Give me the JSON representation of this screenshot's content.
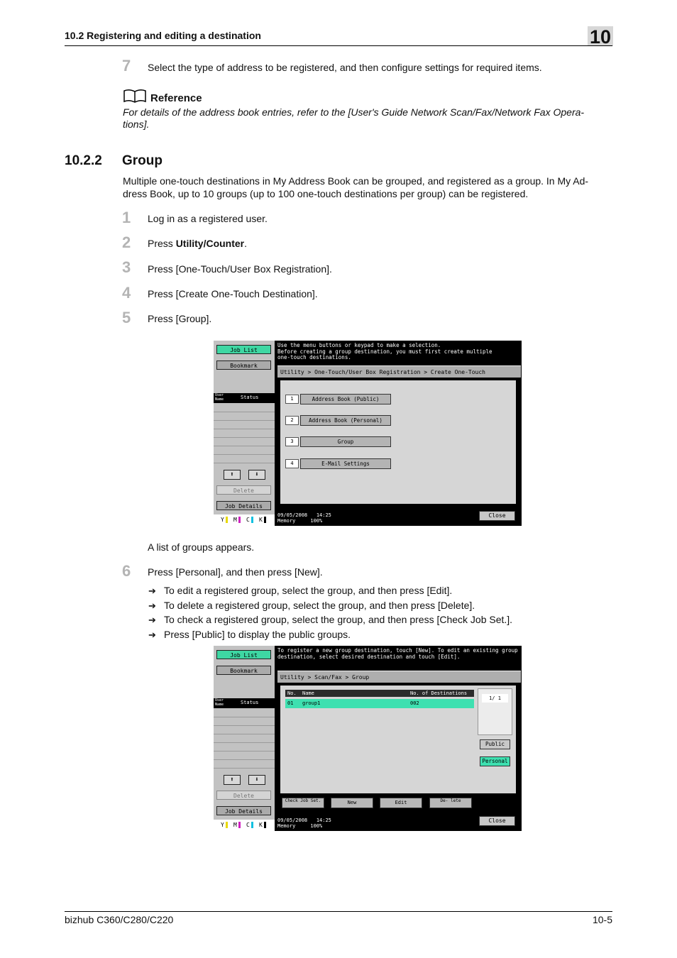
{
  "header": {
    "section": "10.2    Registering and editing a destination",
    "chapter": "10"
  },
  "footer": {
    "product": "bizhub C360/C280/C220",
    "page": "10-5"
  },
  "step7": {
    "num": "7",
    "text": "Select the type of address to be registered, and then configure settings for required items."
  },
  "reference": {
    "title": "Reference",
    "line1": "For details of the address book entries, refer to the [User's Guide Network Scan/Fax/Network Fax Opera-",
    "line2": "tions]."
  },
  "section": {
    "number": "10.2.2",
    "title": "Group",
    "intro1": "Multiple one-touch destinations in My Address Book can be grouped, and registered as a group. In My Ad-",
    "intro2": "dress Book, up to 10 groups (up to 100 one-touch destinations per group) can be registered."
  },
  "steps": [
    {
      "num": "1",
      "text": "Log in as a registered user."
    },
    {
      "num": "2",
      "text_pre": "Press ",
      "text_bold": "Utility/Counter",
      "text_post": "."
    },
    {
      "num": "3",
      "text": "Press [One-Touch/User Box Registration]."
    },
    {
      "num": "4",
      "text": "Press [Create One-Touch Destination]."
    },
    {
      "num": "5",
      "text": "Press [Group]."
    }
  ],
  "after5": "A list of groups appears.",
  "step6": {
    "num": "6",
    "text": "Press [Personal], and then press [New].",
    "bullets": [
      "To edit a registered group, select the group, and then press [Edit].",
      "To delete a registered group, select the group, and then press [Delete].",
      "To check a registered group, select the group, and then press [Check Job Set.].",
      "Press [Public] to display the public groups."
    ],
    "arrow_glyph": "➔"
  },
  "screen_common": {
    "job_list": "Job List",
    "bookmark": "Bookmark",
    "user_name": "User Name",
    "status": "Status",
    "up": "⬆",
    "down": "⬇",
    "delete": "Delete",
    "job_details": "Job Details",
    "toner": [
      "Y",
      "M",
      "C",
      "K"
    ],
    "date": "09/05/2008",
    "time": "14:25",
    "memory_label": "Memory",
    "memory_value": "100%",
    "close": "Close"
  },
  "screen1": {
    "message": [
      "Use the menu buttons or keypad to make a selection.",
      "Before creating a group destination, you must first create multiple",
      "one-touch destinations."
    ],
    "breadcrumb": "Utility > One-Touch/User Box Registration > Create One-Touch Destination",
    "menu": [
      {
        "num": "1",
        "label": "Address Book (Public)"
      },
      {
        "num": "2",
        "label": "Address Book (Personal)"
      },
      {
        "num": "3",
        "label": "Group"
      },
      {
        "num": "4",
        "label": "E-Mail Settings"
      }
    ]
  },
  "screen2": {
    "message": [
      "To register a new group destination, touch [New]. To edit an existing group",
      "destination, select desired destination and touch [Edit]."
    ],
    "breadcrumb": "Utility > Scan/Fax > Group",
    "columns": [
      "No.",
      "Name",
      "No. of Destinations"
    ],
    "rows": [
      {
        "no": "01",
        "name": "group1",
        "count": "002"
      }
    ],
    "pager": "1/  1",
    "public": "Public",
    "personal": "Personal",
    "buttons": [
      "Check Job Set.",
      "New",
      "Edit",
      "De- lete"
    ]
  },
  "colors": {
    "teal": "#3ed7a3",
    "badge": "#d7d7d7",
    "step_num": "#b4b4b4"
  }
}
